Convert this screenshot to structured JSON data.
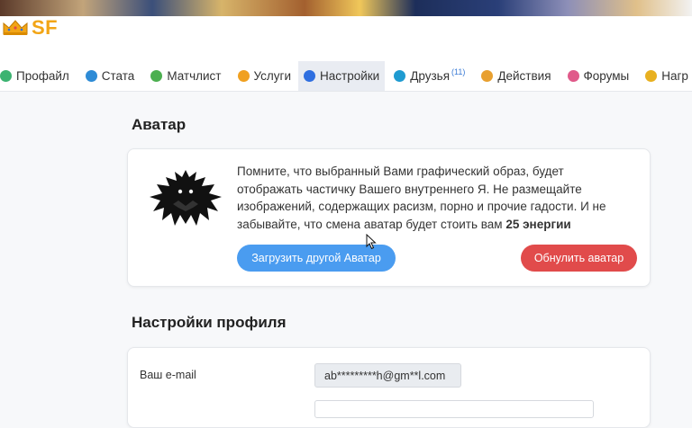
{
  "logo": {
    "text": "SF",
    "icon": "crown-icon"
  },
  "nav": {
    "items": [
      {
        "label": "Профайл",
        "icon": "profile-icon",
        "color": "#3cb371"
      },
      {
        "label": "Стата",
        "icon": "stats-icon",
        "color": "#2e8bd6"
      },
      {
        "label": "Матчлист",
        "icon": "matchlist-icon",
        "color": "#4caf50"
      },
      {
        "label": "Услуги",
        "icon": "services-icon",
        "color": "#f0a020"
      },
      {
        "label": "Настройки",
        "icon": "settings-icon",
        "color": "#2f6fe0",
        "active": true
      },
      {
        "label": "Друзья",
        "icon": "friends-icon",
        "color": "#1f9bd1",
        "badge": "(11)"
      },
      {
        "label": "Действия",
        "icon": "actions-icon",
        "color": "#e8a030"
      },
      {
        "label": "Форумы",
        "icon": "forums-icon",
        "color": "#e05a8a"
      },
      {
        "label": "Нагр",
        "icon": "awards-icon",
        "color": "#e8b020"
      }
    ]
  },
  "avatar": {
    "title": "Аватар",
    "text": "Помните, что выбранный Вами графический образ, будет отображать частичку Вашего внутреннего Я. Не размещайте изображений, содержащих расизм, порно и прочие гадости. И не забывайте, что смена аватар будет стоить вам ",
    "cost": "25 энергии",
    "upload_label": "Загрузить другой Аватар",
    "reset_label": "Обнулить аватар"
  },
  "profile": {
    "title": "Настройки профиля",
    "email_label": "Ваш e-mail",
    "email_value": "ab*********h@gm**l.com"
  },
  "colors": {
    "accent": "#4a9cf0",
    "danger": "#e14b4b",
    "brand": "#f2a516"
  }
}
